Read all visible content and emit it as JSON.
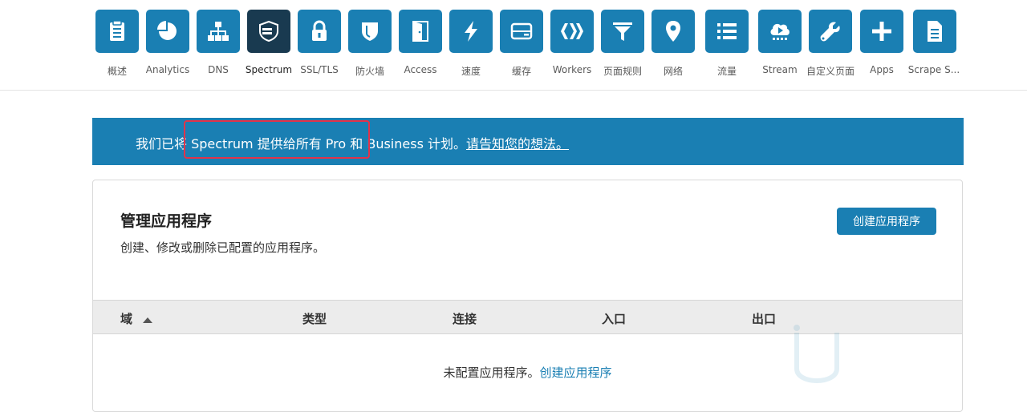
{
  "nav": {
    "items": [
      {
        "label": "概述",
        "icon": "clipboard-icon"
      },
      {
        "label": "Analytics",
        "icon": "pie-chart-icon"
      },
      {
        "label": "DNS",
        "icon": "network-icon"
      },
      {
        "label": "Spectrum",
        "icon": "spectrum-shield-icon",
        "active": true
      },
      {
        "label": "SSL/TLS",
        "icon": "lock-icon"
      },
      {
        "label": "防火墙",
        "icon": "shield-icon"
      },
      {
        "label": "Access",
        "icon": "door-icon"
      },
      {
        "label": "速度",
        "icon": "lightning-icon"
      },
      {
        "label": "缓存",
        "icon": "server-icon"
      },
      {
        "label": "Workers",
        "icon": "workers-icon"
      },
      {
        "label": "页面规则",
        "icon": "filter-icon"
      },
      {
        "label": "网络",
        "icon": "location-pin-icon"
      },
      {
        "label": "流量",
        "icon": "list-icon"
      },
      {
        "label": "Stream",
        "icon": "cloud-play-icon"
      },
      {
        "label": "自定义页面",
        "icon": "wrench-icon"
      },
      {
        "label": "Apps",
        "icon": "plus-icon"
      },
      {
        "label": "Scrape S...",
        "icon": "document-icon"
      }
    ]
  },
  "banner": {
    "text": "我们已将 Spectrum 提供给所有 Pro 和 Business 计划。",
    "link": "请告知您的想法。"
  },
  "panel": {
    "title": "管理应用程序",
    "subtitle": "创建、修改或删除已配置的应用程序。",
    "create_button": "创建应用程序",
    "columns": [
      "域",
      "类型",
      "连接",
      "入口",
      "出口"
    ],
    "empty_text": "未配置应用程序。",
    "empty_link": "创建应用程序"
  },
  "colors": {
    "accent": "#1a7fb3",
    "active_tile": "#193a50",
    "highlight": "#e1334a"
  }
}
